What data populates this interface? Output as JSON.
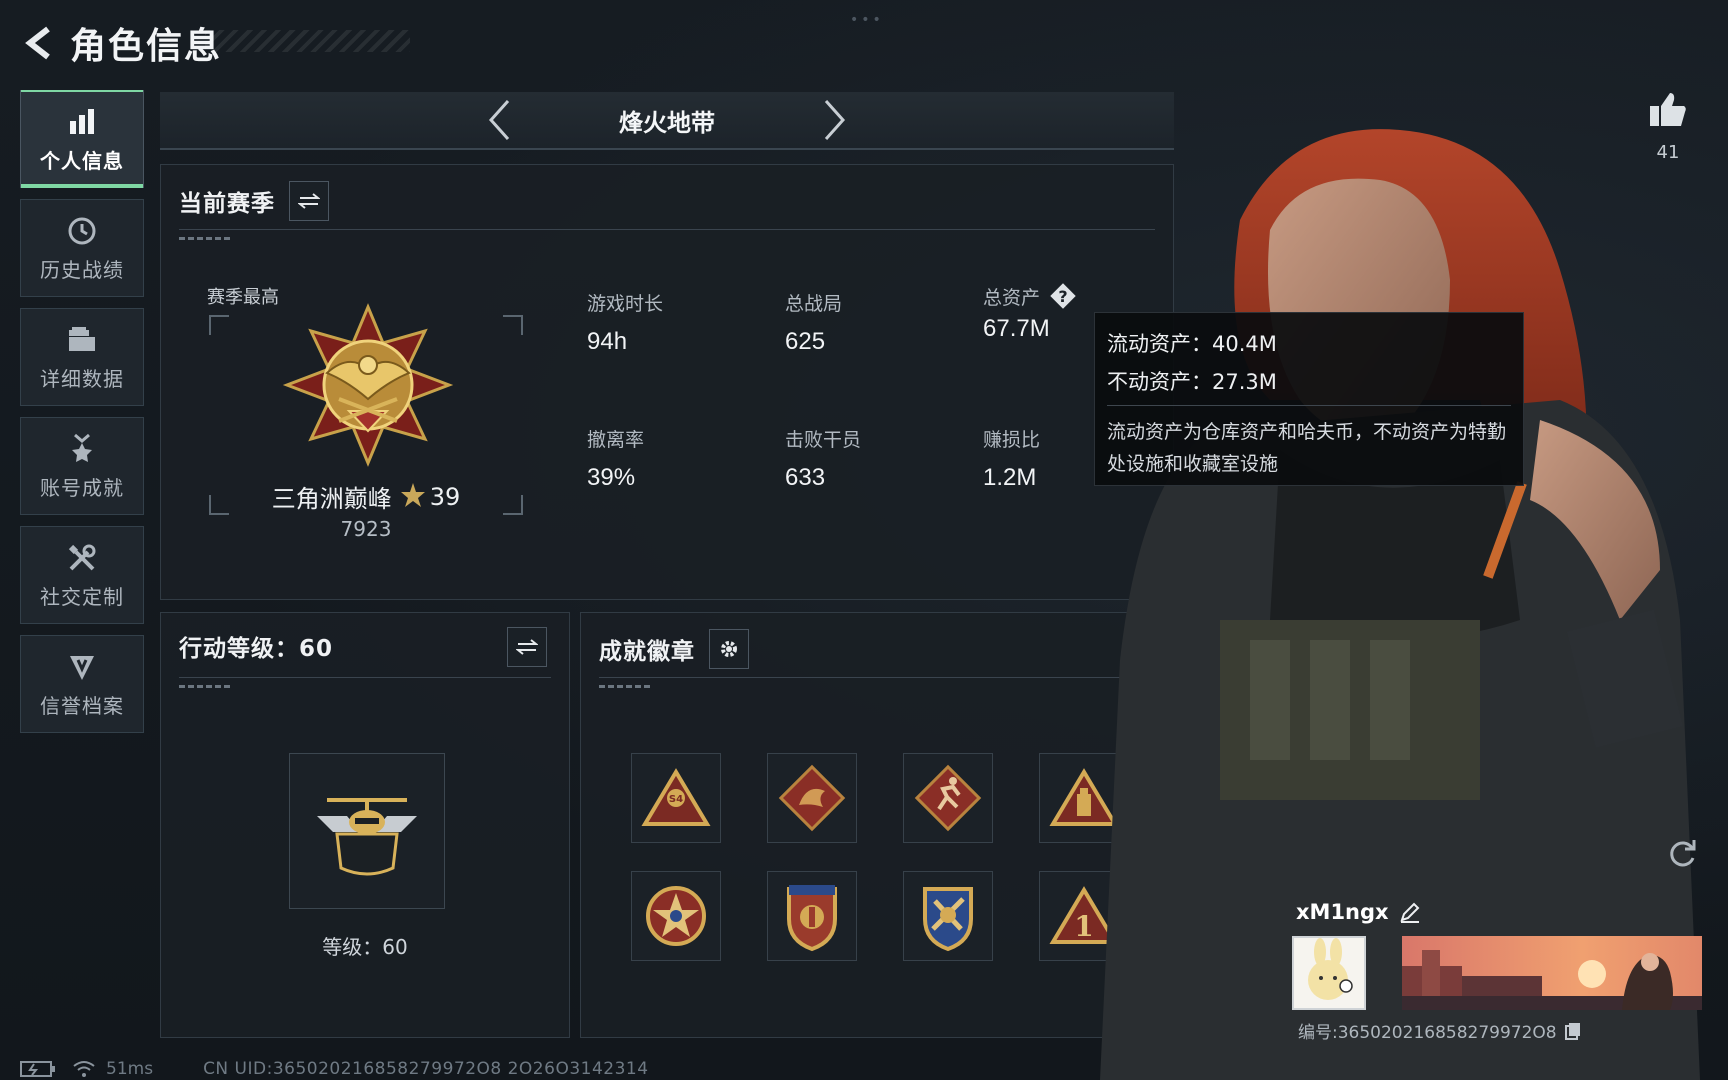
{
  "header": {
    "title": "角色信息"
  },
  "mode_selector": {
    "current": "烽火地带"
  },
  "sidebar": {
    "items": [
      {
        "label": "个人信息",
        "icon": "bar-chart-icon",
        "active": true
      },
      {
        "label": "历史战绩",
        "icon": "history-clock-icon",
        "active": false
      },
      {
        "label": "详细数据",
        "icon": "folder-icon",
        "active": false
      },
      {
        "label": "账号成就",
        "icon": "achievement-medal-icon",
        "active": false
      },
      {
        "label": "社交定制",
        "icon": "tools-icon",
        "active": false
      },
      {
        "label": "信誉档案",
        "icon": "reputation-shield-icon",
        "active": false
      }
    ]
  },
  "season": {
    "title": "当前赛季",
    "best_label": "赛季最高",
    "rank_name": "三角洲巅峰",
    "rank_stars": "39",
    "rank_score": "7923",
    "stats": [
      {
        "label": "游戏时长",
        "value": "94h"
      },
      {
        "label": "总战局",
        "value": "625"
      },
      {
        "label": "总资产",
        "value": "67.7M"
      },
      {
        "label": "撤离率",
        "value": "39%"
      },
      {
        "label": "击败干员",
        "value": "633"
      },
      {
        "label": "赚损比",
        "value": "1.2M"
      }
    ]
  },
  "tooltip": {
    "liquid": "流动资产：40.4M",
    "fixed": "不动资产：27.3M",
    "note": "流动资产为仓库资产和哈夫币，不动资产为特勤处设施和收藏室设施"
  },
  "action_level": {
    "title": "行动等级：60",
    "level_text": "等级：60"
  },
  "achievements": {
    "title": "成就徽章",
    "badges": [
      "s4-triangle-badge-icon",
      "dragon-diamond-badge-icon",
      "runner-diamond-badge-icon",
      "usb-triangle-badge-icon",
      "star-round-badge-icon",
      "shield-stars-badge-icon",
      "wrench-shield-badge-icon",
      "number-one-triangle-badge-icon"
    ]
  },
  "player": {
    "likes": "41",
    "name": "xM1ngx",
    "id_text": "编号:365020216858279972O8"
  },
  "status_bar": {
    "ping": "51ms",
    "uid": "CN UID:365020216858279972O8 2O26O3142314"
  },
  "colors": {
    "accent_green": "#7fd8a4",
    "gold": "#c8a24a",
    "badge_red": "#8a2e26",
    "panel_bg": "#191f25"
  }
}
